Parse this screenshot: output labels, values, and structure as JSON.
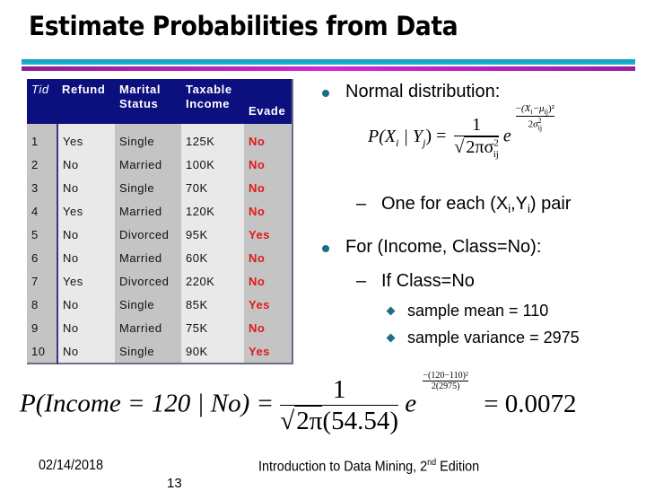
{
  "slide": {
    "title": "Estimate Probabilities from Data",
    "accent_colors": {
      "rule_top": "#22b7d4",
      "rule_bottom": "#c823c8",
      "table_header": "#0c0f7e",
      "class_label": "#e01a1a",
      "bullet": "#1a6e86"
    }
  },
  "table": {
    "headers": {
      "tid": "Tid",
      "refund": "Refund",
      "marital_1": "Marital",
      "marital_2": "Status",
      "income_1": "Taxable",
      "income_2": "Income",
      "evade": "Evade"
    },
    "rows": [
      {
        "tid": "1",
        "refund": "Yes",
        "marital": "Single",
        "income": "125K",
        "evade": "No"
      },
      {
        "tid": "2",
        "refund": "No",
        "marital": "Married",
        "income": "100K",
        "evade": "No"
      },
      {
        "tid": "3",
        "refund": "No",
        "marital": "Single",
        "income": "70K",
        "evade": "No"
      },
      {
        "tid": "4",
        "refund": "Yes",
        "marital": "Married",
        "income": "120K",
        "evade": "No"
      },
      {
        "tid": "5",
        "refund": "No",
        "marital": "Divorced",
        "income": "95K",
        "evade": "Yes"
      },
      {
        "tid": "6",
        "refund": "No",
        "marital": "Married",
        "income": "60K",
        "evade": "No"
      },
      {
        "tid": "7",
        "refund": "Yes",
        "marital": "Divorced",
        "income": "220K",
        "evade": "No"
      },
      {
        "tid": "8",
        "refund": "No",
        "marital": "Single",
        "income": "85K",
        "evade": "Yes"
      },
      {
        "tid": "9",
        "refund": "No",
        "marital": "Married",
        "income": "75K",
        "evade": "No"
      },
      {
        "tid": "10",
        "refund": "No",
        "marital": "Single",
        "income": "90K",
        "evade": "Yes"
      }
    ]
  },
  "bullets": {
    "normal": "Normal distribution:",
    "one_each_pre": "One for each (X",
    "one_each_i": "i",
    "one_each_mid": ",Y",
    "one_each_j": "i",
    "one_each_post": ") pair",
    "income_class": "For (Income, Class=No):",
    "if_class": "If Class=No",
    "mean": "sample mean = 110",
    "variance": "sample variance = 2975",
    "dash": "–"
  },
  "formula_general": {
    "lhs": "P(X",
    "lhs_i": "i",
    "lhs_mid": " | Y",
    "lhs_j": "j",
    "lhs_end": ") =",
    "num": "1",
    "den": "2πσ",
    "den_sub": "ij",
    "den_sup": "2",
    "e": "e",
    "exp_num": "(X",
    "exp_num_i": "i",
    "exp_num_mid": "−μ",
    "exp_num_ij": "ij",
    "exp_num_end": ")²",
    "exp_den": "2σ",
    "exp_den_sub": "ij",
    "exp_den_sup": "2",
    "minus": "−"
  },
  "formula_specific": {
    "lhs": "P(Income = 120 | No) =",
    "num": "1",
    "den_sqrt": "2π",
    "den_rest": "(54.54)",
    "e": "e",
    "exp_num": "(120−110)²",
    "exp_den": "2(2975)",
    "minus": "−",
    "result": "= 0.0072"
  },
  "footer": {
    "date": "02/14/2018",
    "book_pre": "Introduction to Data Mining, 2",
    "book_sup": "nd",
    "book_post": " Edition",
    "page": "13"
  }
}
